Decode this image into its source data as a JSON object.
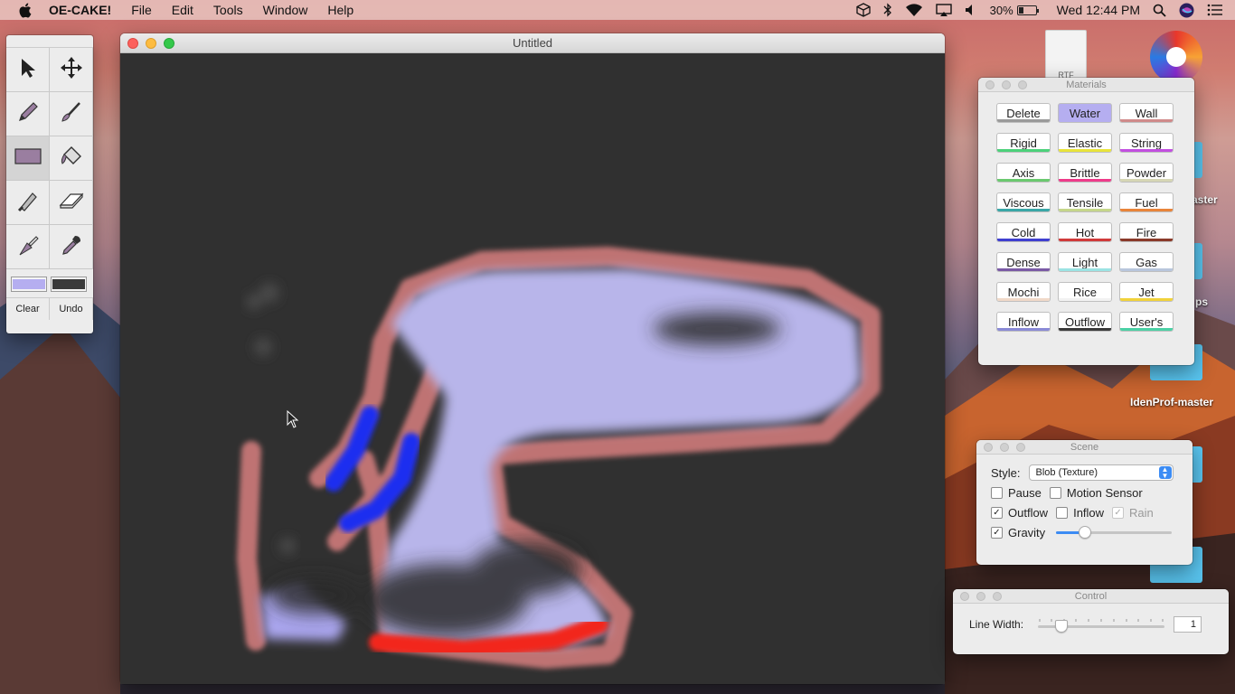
{
  "menubar": {
    "app_name": "OE-CAKE!",
    "menus": [
      "File",
      "Edit",
      "Tools",
      "Window",
      "Help"
    ],
    "battery": "30%",
    "battery_level": 0.3,
    "clock": "Wed 12:44 PM",
    "icons": [
      "apple-icon",
      "box-icon",
      "bluetooth-icon",
      "wifi-icon",
      "airplay-icon",
      "volume-icon",
      "battery-icon",
      "spotlight-icon",
      "siri-icon",
      "list-icon"
    ]
  },
  "desktop": {
    "file_badge": "RTF",
    "labels": [
      "aster",
      "ps",
      "IdenProf-master"
    ]
  },
  "main_window": {
    "title": "Untitled"
  },
  "tools": {
    "icons": [
      "arrow-icon",
      "move-icon",
      "pencil-icon",
      "brush-icon",
      "rectangle-icon",
      "fill-bucket-icon",
      "knife-icon",
      "eraser-icon",
      "torch-icon",
      "dropper-icon"
    ],
    "primary_color": "#b5aef0",
    "secondary_color": "#3a3a3a",
    "clear_label": "Clear",
    "undo_label": "Undo"
  },
  "materials": {
    "title": "Materials",
    "items": [
      {
        "label": "Delete",
        "color": "#9a9a9a"
      },
      {
        "label": "Water",
        "color": "#b5aef0"
      },
      {
        "label": "Wall",
        "color": "#d08a8a"
      },
      {
        "label": "Rigid",
        "color": "#4cd17a"
      },
      {
        "label": "Elastic",
        "color": "#e8e43a"
      },
      {
        "label": "String",
        "color": "#c24fe0"
      },
      {
        "label": "Axis",
        "color": "#6ac96f"
      },
      {
        "label": "Brittle",
        "color": "#ee3b8a"
      },
      {
        "label": "Powder",
        "color": "#d6d6b4"
      },
      {
        "label": "Viscous",
        "color": "#3aa7a7"
      },
      {
        "label": "Tensile",
        "color": "#c5d68a"
      },
      {
        "label": "Fuel",
        "color": "#e8843a"
      },
      {
        "label": "Cold",
        "color": "#4040d0"
      },
      {
        "label": "Hot",
        "color": "#d03a3a"
      },
      {
        "label": "Fire",
        "color": "#8a3a2a"
      },
      {
        "label": "Dense",
        "color": "#7a5aa5"
      },
      {
        "label": "Light",
        "color": "#9be3e3"
      },
      {
        "label": "Gas",
        "color": "#b8c6dc"
      },
      {
        "label": "Mochi",
        "color": "#f0d9c8"
      },
      {
        "label": "Rice",
        "color": "#f2f2f2"
      },
      {
        "label": "Jet",
        "color": "#f1d23a"
      },
      {
        "label": "Inflow",
        "color": "#8a8ad6"
      },
      {
        "label": "Outflow",
        "color": "#3a3a3a"
      },
      {
        "label": "User's",
        "color": "#4bd1a5"
      }
    ]
  },
  "scene": {
    "title": "Scene",
    "style_label": "Style:",
    "style_value": "Blob (Texture)",
    "pause": "Pause",
    "motion_sensor": "Motion Sensor",
    "outflow": "Outflow",
    "inflow": "Inflow",
    "rain": "Rain",
    "gravity": "Gravity",
    "gravity_level": 0.22
  },
  "control": {
    "title": "Control",
    "line_width_label": "Line Width:",
    "line_width_value": "1",
    "line_width_level": 0.15
  }
}
